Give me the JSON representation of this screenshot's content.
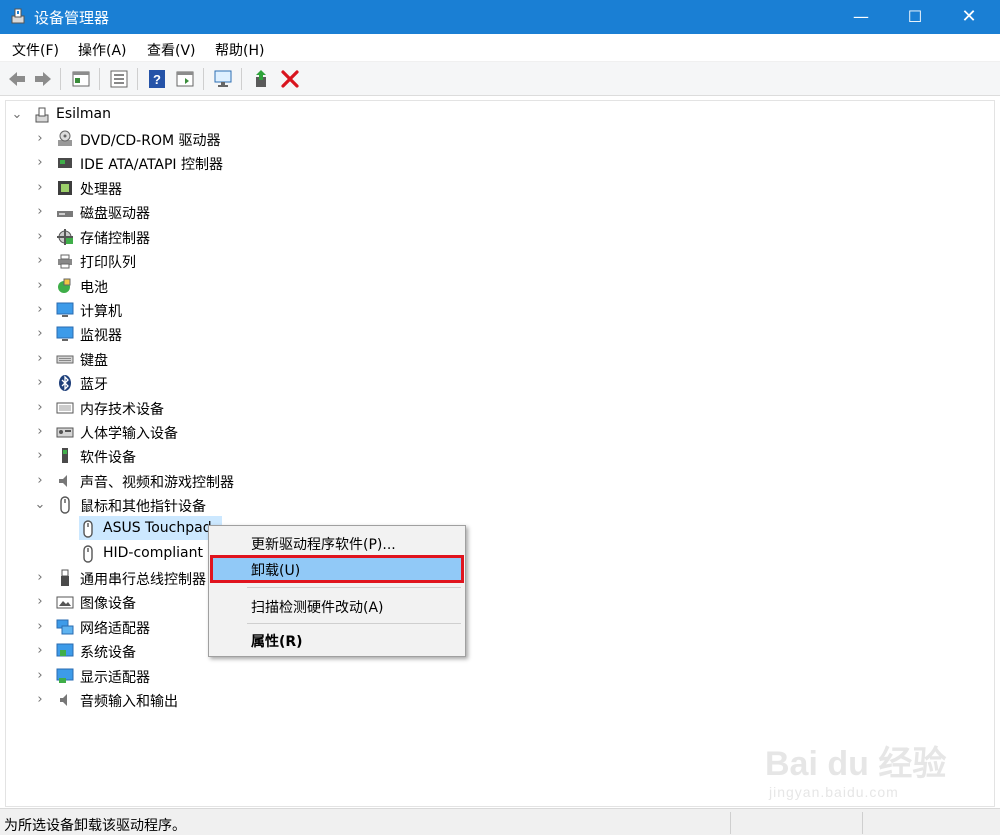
{
  "window": {
    "title": "设备管理器",
    "minimize": "—",
    "maximize": "☐",
    "close": "✕"
  },
  "menu": [
    "文件(F)",
    "操作(A)",
    "查看(V)",
    "帮助(H)"
  ],
  "toolbar": [
    "back-icon",
    "forward-icon",
    "properties-view-icon",
    "list-view-icon",
    "help-icon",
    "run-icon",
    "scan-hardware-icon",
    "update-driver-icon",
    "uninstall-icon"
  ],
  "tree": {
    "root": "Esilman",
    "categories": [
      "DVD/CD-ROM 驱动器",
      "IDE ATA/ATAPI 控制器",
      "处理器",
      "磁盘驱动器",
      "存储控制器",
      "打印队列",
      "电池",
      "计算机",
      "监视器",
      "键盘",
      "蓝牙",
      "内存技术设备",
      "人体学输入设备",
      "软件设备",
      "声音、视频和游戏控制器",
      "鼠标和其他指针设备",
      "通用串行总线控制器",
      "图像设备",
      "网络适配器",
      "系统设备",
      "显示适配器",
      "音频输入和输出"
    ],
    "mouse_children": [
      "ASUS Touchpad",
      "HID-compliant"
    ]
  },
  "context_menu": {
    "items": [
      "更新驱动程序软件(P)...",
      "卸载(U)",
      "扫描检测硬件改动(A)",
      "属性(R)"
    ],
    "highlighted": "卸载(U)"
  },
  "status": {
    "text": "为所选设备卸载该驱动程序。"
  },
  "watermark": {
    "big": "Bai du 经验",
    "small": "jingyan.baidu.com"
  },
  "colors": {
    "titlebar": "#1a7fd4",
    "selection": "#cce8ff",
    "menu_highlight": "#91c9f7",
    "red_box": "#e0141e"
  }
}
